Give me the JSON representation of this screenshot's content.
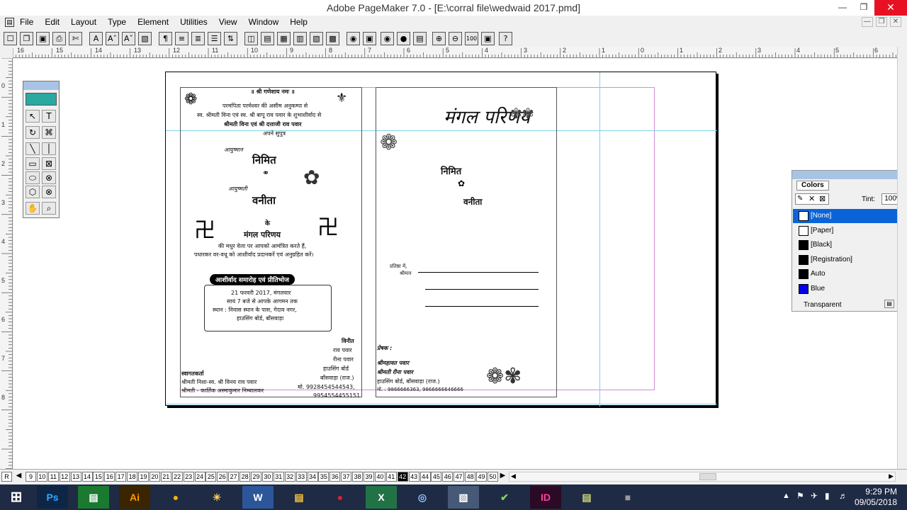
{
  "app": {
    "title": "Adobe PageMaker 7.0 - [E:\\corral file\\wedwaid  2017.pmd]",
    "window_controls": [
      "—",
      "❐",
      "✕"
    ]
  },
  "menu": {
    "items": [
      "File",
      "Edit",
      "Layout",
      "Type",
      "Element",
      "Utilities",
      "View",
      "Window",
      "Help"
    ]
  },
  "toolbar": {
    "buttons": [
      "☐",
      "❐",
      "▣",
      "⎙",
      "✄",
      "A",
      "Aˆ",
      "Aˇ",
      "▧",
      "¶",
      "≡",
      "≣",
      "☰",
      "⇅",
      "◫",
      "▤",
      "▦",
      "▥",
      "▧",
      "▩",
      "◉",
      "▣",
      "⊕",
      "⊖",
      "100",
      "▣",
      "?"
    ]
  },
  "ruler": {
    "h_labels": [
      "16",
      "15",
      "14",
      "13",
      "12",
      "11",
      "10",
      "9",
      "8",
      "7",
      "6",
      "5",
      "4",
      "3",
      "2",
      "1",
      "0",
      "1",
      "2",
      "3",
      "4",
      "5",
      "6"
    ],
    "v_labels": [
      "0",
      "1",
      "2",
      "3",
      "4",
      "5",
      "6",
      "7",
      "8"
    ]
  },
  "toolbox": {
    "tools": [
      "↖",
      "T",
      "↻",
      "⌘",
      "╲",
      "│",
      "▭",
      "⊠",
      "⬭",
      "⊗",
      "⬡",
      "⊗",
      "✋",
      "⌕"
    ]
  },
  "colors_panel": {
    "tab": "Colors",
    "tint_label": "Tint:",
    "tint_value": "100%",
    "items": [
      {
        "name": "[None]",
        "swatch": "#ffffff",
        "selected": true
      },
      {
        "name": "[Paper]",
        "swatch": "#ffffff"
      },
      {
        "name": "[Black]",
        "swatch": "#000000"
      },
      {
        "name": "[Registration]",
        "swatch": "#000000"
      },
      {
        "name": "Auto",
        "swatch": "#000000"
      },
      {
        "name": "Blue",
        "swatch": "#0000ee"
      }
    ],
    "transparent": "Transparent"
  },
  "document": {
    "left": {
      "top_line": "॥ श्री गणेशाय नमः ॥",
      "line1": "परमपिता परमेश्वर की असीम अनुकम्पा से",
      "line2": "स्व. श्रीमती विना एवं स्व. श्री बापू राव पवार के शुभाशीर्वाद से",
      "line3": "श्रीमती विना एवं श्री दत्ताजी राव पवार",
      "line4": "अपने सुपुत्र",
      "groom_prefix": "आयुष्मान",
      "groom": "निमित",
      "bride_prefix": "आयुष्मती",
      "bride": "वनीता",
      "ke": "के",
      "event": "मंगल परिणय",
      "invite1": "की मधुर वेला पर आपको आमंत्रित करते हैं,",
      "invite2": "पधारकर वर-वधू को आशीर्वाद प्रदानकरें एवं अनुग्रहित करें।",
      "banner": "आशीर्वाद समारोह एवं प्रीतिभोज",
      "date": "21 फरवरी 2017, मंगलवार",
      "time": "सायं 7 बजे से आपके आगमन तक",
      "place1": "स्थान : निवास स्थान के पास, गेदाव नगर,",
      "place2": "हाउसिंग बोर्ड, बाँसवाड़ा",
      "vinit": "विनीत",
      "vinit1": "राव पवार",
      "vinit2": "रीना पवार",
      "vinit3": "हाउसिंग बोर्ड",
      "vinit4": "बाँसवाड़ा (राज.)",
      "phone1": "मो. 9928454544543,",
      "phone2": "9954554455151",
      "welcome": "स्वागतकर्ता",
      "welcome1": "श्रीमती निशा-स्व. श्री विनय राव पवार",
      "welcome2": "श्रीमती - कार्तिक अस्माकुमार निम्बालकर"
    },
    "right": {
      "heading": "मंगल परिणय",
      "groom": "निमित",
      "bride": "वनीता",
      "to1": "प्रतिष्ठा में,",
      "to2": "श्रीमान",
      "sender": "प्रेषक :",
      "sender1": "श्रीमहावत पवार",
      "sender2": "श्रीमती रीना पवार",
      "sender3": "हाउसिंग बोर्ड, बाँसवाड़ा (राज.)",
      "sender4": "मो. : 9866666363, 9866666646666"
    }
  },
  "pages": {
    "prev": "R",
    "list": [
      "9",
      "10",
      "11",
      "12",
      "13",
      "14",
      "15",
      "16",
      "17",
      "18",
      "19",
      "20",
      "21",
      "22",
      "23",
      "24",
      "25",
      "26",
      "27",
      "28",
      "29",
      "30",
      "31",
      "32",
      "33",
      "34",
      "35",
      "36",
      "37",
      "38",
      "39",
      "40",
      "41",
      "42",
      "43",
      "44",
      "45",
      "46",
      "47",
      "48",
      "49",
      "50"
    ],
    "active": "42"
  },
  "taskbar": {
    "apps": [
      "Ps",
      "▤",
      "Ai",
      "●",
      "☀",
      "W",
      "▤",
      "●",
      "X",
      "◎",
      "▧",
      "✔",
      "ID",
      "▤",
      "■"
    ],
    "time": "9:29 PM",
    "date": "09/05/2018"
  }
}
